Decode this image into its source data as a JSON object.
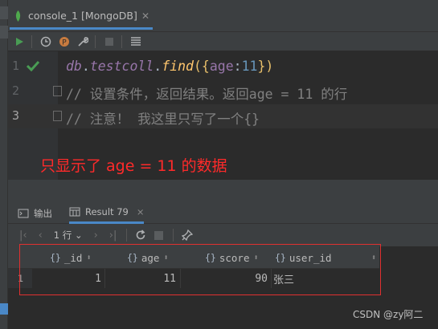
{
  "tab": {
    "title": "console_1 [MongoDB]"
  },
  "toolbar": {
    "icons": [
      "run-icon",
      "history-icon",
      "parameter-icon",
      "settings-icon",
      "stop-icon",
      "output-layout-icon"
    ]
  },
  "editor": {
    "lines": [
      {
        "number": "1",
        "var": "db",
        "dot1": ".",
        "coll": "testcoll",
        "dot2": ".",
        "fn": "find",
        "open": "(",
        "brace_open": "{",
        "key": "age",
        "colon": ":",
        "value": "11",
        "brace_close": "}",
        "close": ")"
      },
      {
        "number": "2",
        "comment": "// 设置条件，返回结果。返回age = 11 的行"
      },
      {
        "number": "3",
        "comment": "// 注意！ 我这里只写了一个{}"
      }
    ]
  },
  "annotation": {
    "text": "只显示了 age = 11 的数据"
  },
  "bottom_panel": {
    "tabs": [
      {
        "label": "输出",
        "icon": "output-icon"
      },
      {
        "label": "Result 79",
        "icon": "table-icon",
        "close": "×"
      }
    ],
    "nav": {
      "rows": "1 行",
      "rows_caret": "⌄"
    }
  },
  "result_grid": {
    "columns": [
      {
        "brace": "{}",
        "name": "_id",
        "sort": "⬍"
      },
      {
        "brace": "{}",
        "name": "age",
        "sort": "⬍"
      },
      {
        "brace": "{}",
        "name": "score",
        "sort": "⬍"
      },
      {
        "brace": "{}",
        "name": "user_id",
        "sort": "⬍"
      }
    ],
    "rows": [
      {
        "row_number": "1",
        "_id": "1",
        "age": "11",
        "score": "90",
        "user_id": "张三"
      }
    ]
  },
  "watermark": "CSDN @zy阿二",
  "colors": {
    "accent": "#4a88c7",
    "annotation_red": "#ff2a2a",
    "highlight_box": "#e03030",
    "run_green": "#499c54"
  }
}
